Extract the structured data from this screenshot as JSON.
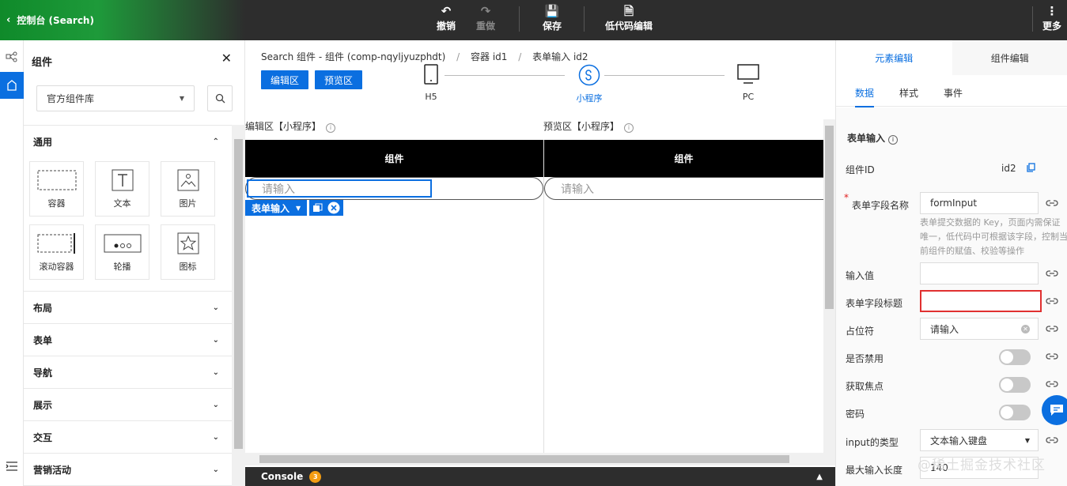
{
  "topbar": {
    "title": "控制台 (Search)",
    "undo": "撤销",
    "redo": "重做",
    "save": "保存",
    "lowcode": "低代码编辑",
    "more": "更多"
  },
  "panel": {
    "title": "组件",
    "library": "官方组件库",
    "groups_open": "通用",
    "tiles": [
      "容器",
      "文本",
      "图片",
      "滚动容器",
      "轮播",
      "图标"
    ],
    "groups": [
      "布局",
      "表单",
      "导航",
      "展示",
      "交互",
      "营销活动"
    ]
  },
  "center": {
    "crumb": [
      "Search 组件 - 组件 (comp-nqyljyuzphdt)",
      "容器 id1",
      "表单输入 id2"
    ],
    "edit_btn": "编辑区",
    "preview_btn": "预览区",
    "devices": [
      "H5",
      "小程序",
      "PC"
    ],
    "edit_label": "编辑区【小程序】",
    "preview_label": "预览区【小程序】",
    "zone_title": "组件",
    "input_placeholder": "请输入",
    "toolbar_label": "表单输入",
    "console": "Console",
    "console_count": "3"
  },
  "right": {
    "tabs": [
      "元素编辑",
      "组件编辑"
    ],
    "subtabs": [
      "数据",
      "样式",
      "事件"
    ],
    "section": "表单输入",
    "id_label": "组件ID",
    "id_value": "id2",
    "field_name_label": "表单字段名称",
    "field_name_value": "formInput",
    "hint": "表单提交数据的 Key，页面内需保证唯一，低代码中可根据该字段，控制当前组件的赋值、校验等操作",
    "input_value_label": "输入值",
    "field_title_label": "表单字段标题",
    "placeholder_label": "占位符",
    "placeholder_value": "请输入",
    "disabled_label": "是否禁用",
    "focus_label": "获取焦点",
    "password_label": "密码",
    "type_label": "input的类型",
    "type_value": "文本输入键盘",
    "maxlen_label": "最大输入长度",
    "maxlen_value": "140"
  },
  "watermark": "@稀土掘金技术社区"
}
